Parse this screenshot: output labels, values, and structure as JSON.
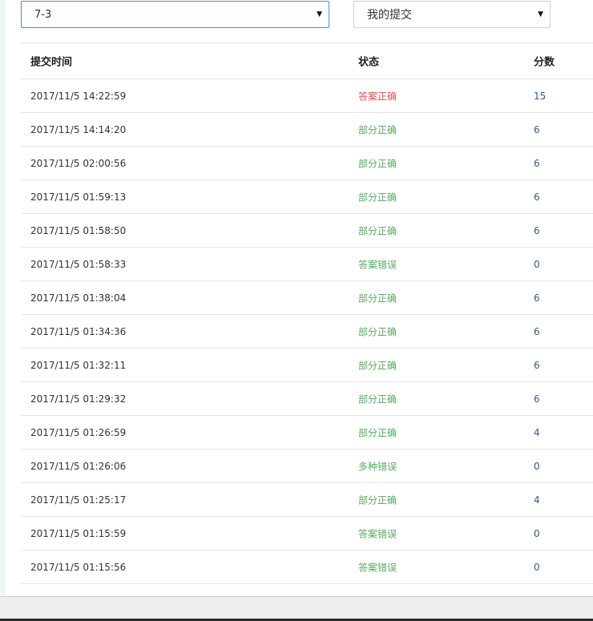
{
  "filters": {
    "problem_selected": "7-3",
    "scope_selected": "我的提交"
  },
  "table": {
    "headers": {
      "time": "提交时间",
      "status": "状态",
      "score": "分数"
    },
    "rows": [
      {
        "time": "2017/11/5 14:22:59",
        "status": "答案正确",
        "score": "15"
      },
      {
        "time": "2017/11/5 14:14:20",
        "status": "部分正确",
        "score": "6"
      },
      {
        "time": "2017/11/5 02:00:56",
        "status": "部分正确",
        "score": "6"
      },
      {
        "time": "2017/11/5 01:59:13",
        "status": "部分正确",
        "score": "6"
      },
      {
        "time": "2017/11/5 01:58:50",
        "status": "部分正确",
        "score": "6"
      },
      {
        "time": "2017/11/5 01:58:33",
        "status": "答案错误",
        "score": "0"
      },
      {
        "time": "2017/11/5 01:38:04",
        "status": "部分正确",
        "score": "6"
      },
      {
        "time": "2017/11/5 01:34:36",
        "status": "部分正确",
        "score": "6"
      },
      {
        "time": "2017/11/5 01:32:11",
        "status": "部分正确",
        "score": "6"
      },
      {
        "time": "2017/11/5 01:29:32",
        "status": "部分正确",
        "score": "6"
      },
      {
        "time": "2017/11/5 01:26:59",
        "status": "部分正确",
        "score": "4"
      },
      {
        "time": "2017/11/5 01:26:06",
        "status": "多种错误",
        "score": "0"
      },
      {
        "time": "2017/11/5 01:25:17",
        "status": "部分正确",
        "score": "4"
      },
      {
        "time": "2017/11/5 01:15:59",
        "status": "答案错误",
        "score": "0"
      },
      {
        "time": "2017/11/5 01:15:56",
        "status": "答案错误",
        "score": "0"
      }
    ]
  },
  "colors": {
    "accepted": "#d9534f",
    "other_status": "#5aa860",
    "score": "#2f5d8a"
  }
}
